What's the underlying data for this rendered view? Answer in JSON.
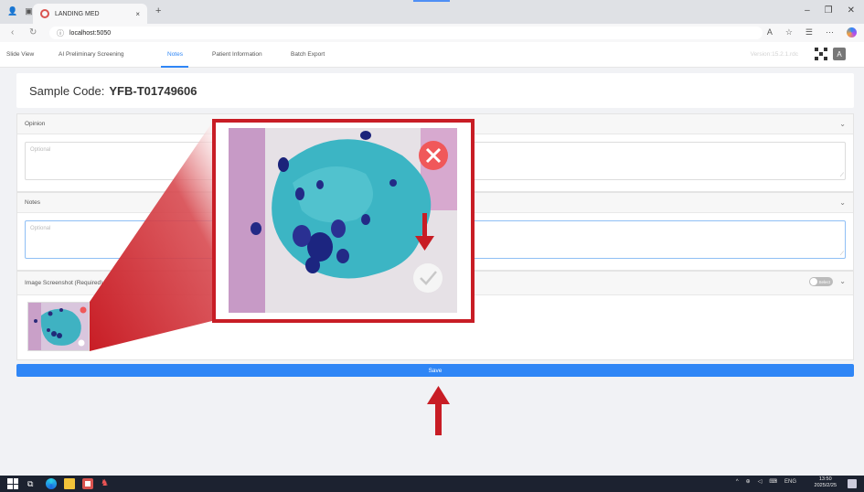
{
  "browser": {
    "tab_title": "LANDING MED",
    "tab_close": "×",
    "new_tab": "+",
    "url": "localhost:5050"
  },
  "appnav": {
    "items": [
      {
        "label": "Slide View"
      },
      {
        "label": "AI Preliminary Screening"
      },
      {
        "label": "Notes"
      },
      {
        "label": "Patient Information"
      },
      {
        "label": "Batch Export"
      }
    ],
    "active": "Notes",
    "version": "Version:15.2.1.rdc"
  },
  "sample": {
    "label": "Sample Code:",
    "code": "YFB-T01749606"
  },
  "opinion": {
    "title": "Opinion",
    "placeholder": "Optional"
  },
  "notes": {
    "title": "Notes",
    "placeholder": "Optional"
  },
  "screenshot": {
    "title": "Image Screenshot (Required)",
    "toggle_label": "Select"
  },
  "save_label": "Save",
  "taskbar": {
    "lang": "ENG",
    "time": "13:50",
    "date": "2025/2/25"
  },
  "colors": {
    "accent": "#2f86f6",
    "callout": "#c81d25"
  }
}
